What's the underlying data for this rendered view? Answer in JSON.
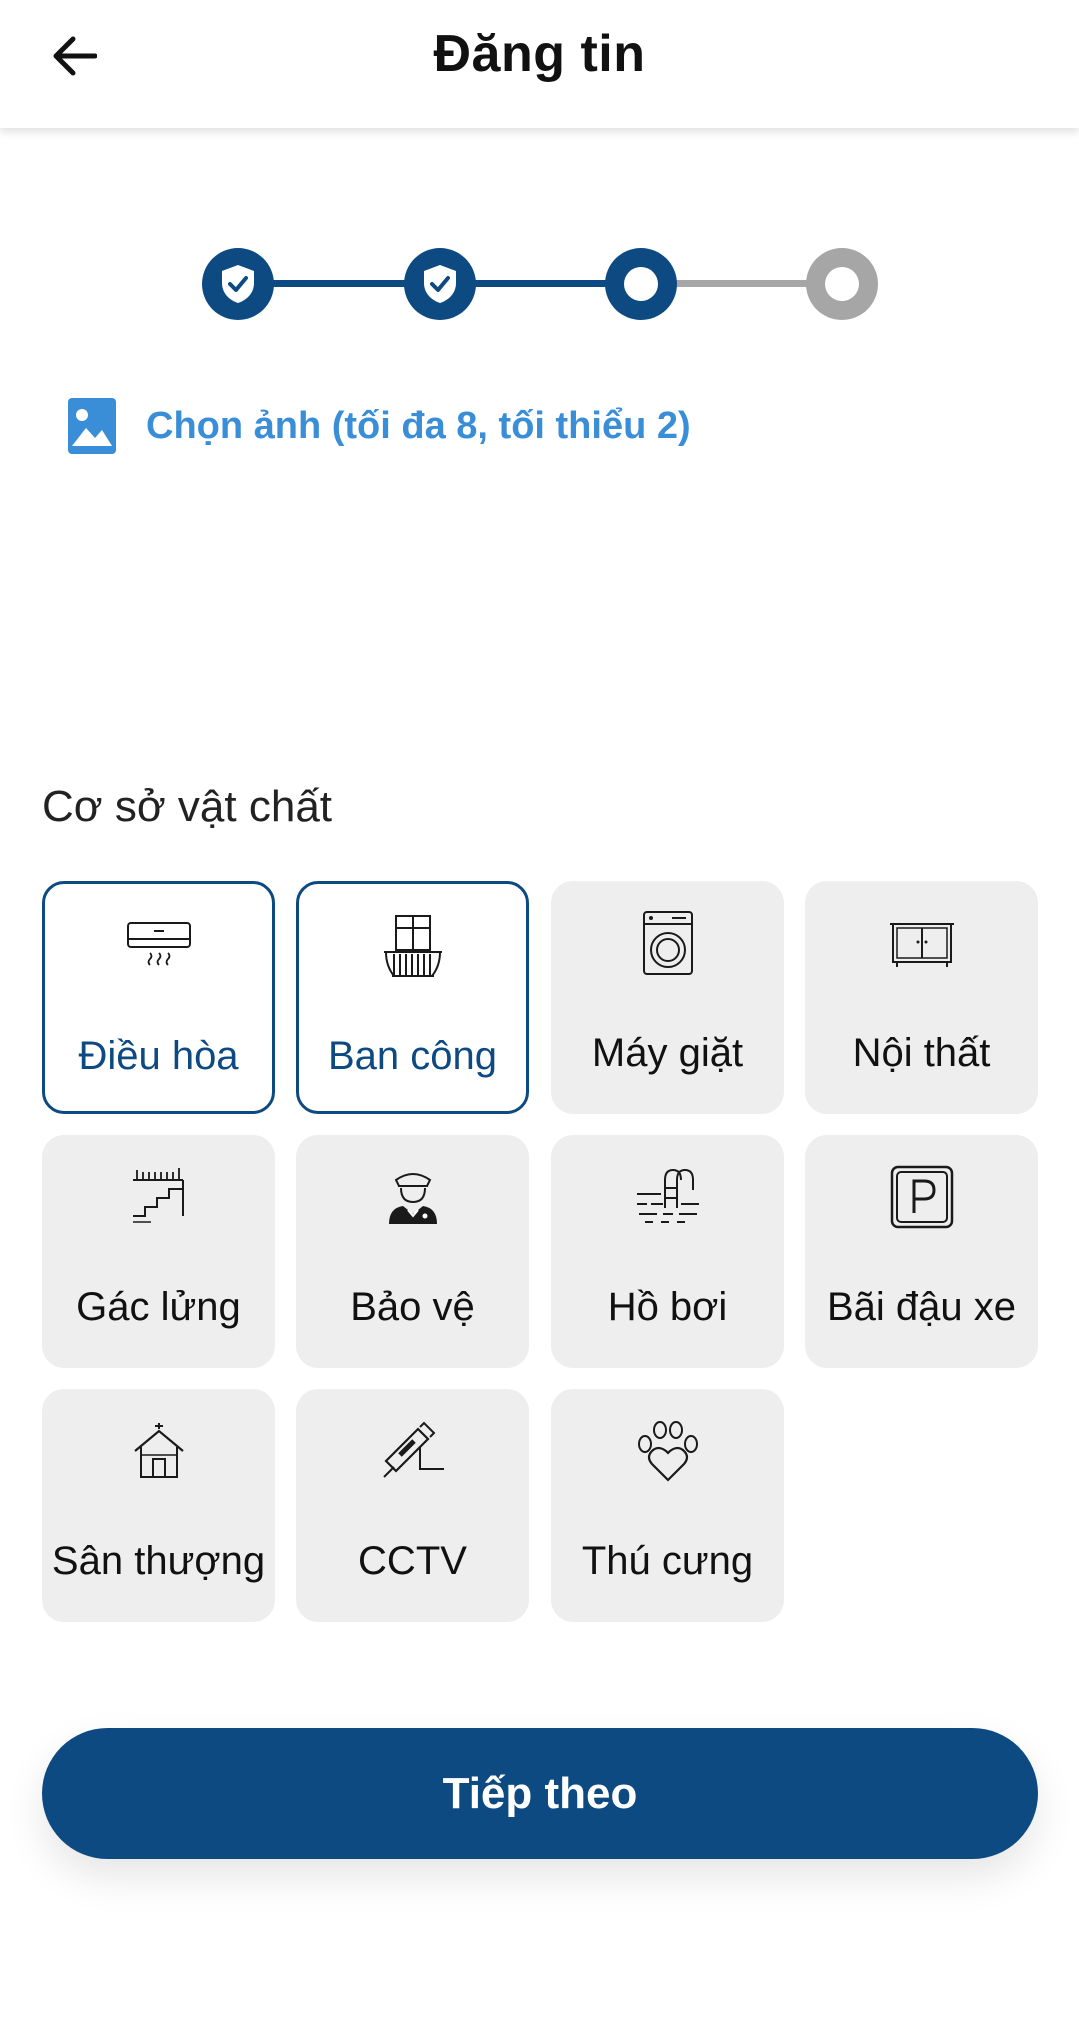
{
  "header": {
    "title": "Đăng tin",
    "back_icon": "arrow-left-icon"
  },
  "stepper": {
    "steps": [
      {
        "status": "done",
        "icon": "shield-check-icon"
      },
      {
        "status": "done",
        "icon": "shield-check-icon"
      },
      {
        "status": "current"
      },
      {
        "status": "pending"
      }
    ],
    "colors": {
      "active": "#0e4a82",
      "inactive": "#a6a6a6"
    }
  },
  "photo_picker": {
    "label": "Chọn ảnh (tối đa 8, tối thiểu 2)",
    "icon": "image-icon",
    "color": "#3a8ed8"
  },
  "facilities": {
    "title": "Cơ sở vật chất",
    "items": [
      {
        "label": "Điều hòa",
        "icon": "air-conditioner-icon",
        "selected": true
      },
      {
        "label": "Ban công",
        "icon": "balcony-icon",
        "selected": true
      },
      {
        "label": "Máy giặt",
        "icon": "washing-machine-icon",
        "selected": false
      },
      {
        "label": "Nội thất",
        "icon": "cabinet-icon",
        "selected": false
      },
      {
        "label": "Gác lửng",
        "icon": "stairs-icon",
        "selected": false
      },
      {
        "label": "Bảo vệ",
        "icon": "security-guard-icon",
        "selected": false
      },
      {
        "label": "Hồ bơi",
        "icon": "pool-icon",
        "selected": false
      },
      {
        "label": "Bãi đậu xe",
        "icon": "parking-icon",
        "selected": false
      },
      {
        "label": "Sân thượng",
        "icon": "rooftop-icon",
        "selected": false
      },
      {
        "label": "CCTV",
        "icon": "cctv-icon",
        "selected": false
      },
      {
        "label": "Thú cưng",
        "icon": "paw-icon",
        "selected": false
      }
    ]
  },
  "next_button": {
    "label": "Tiếp theo",
    "color": "#0e4a82"
  }
}
